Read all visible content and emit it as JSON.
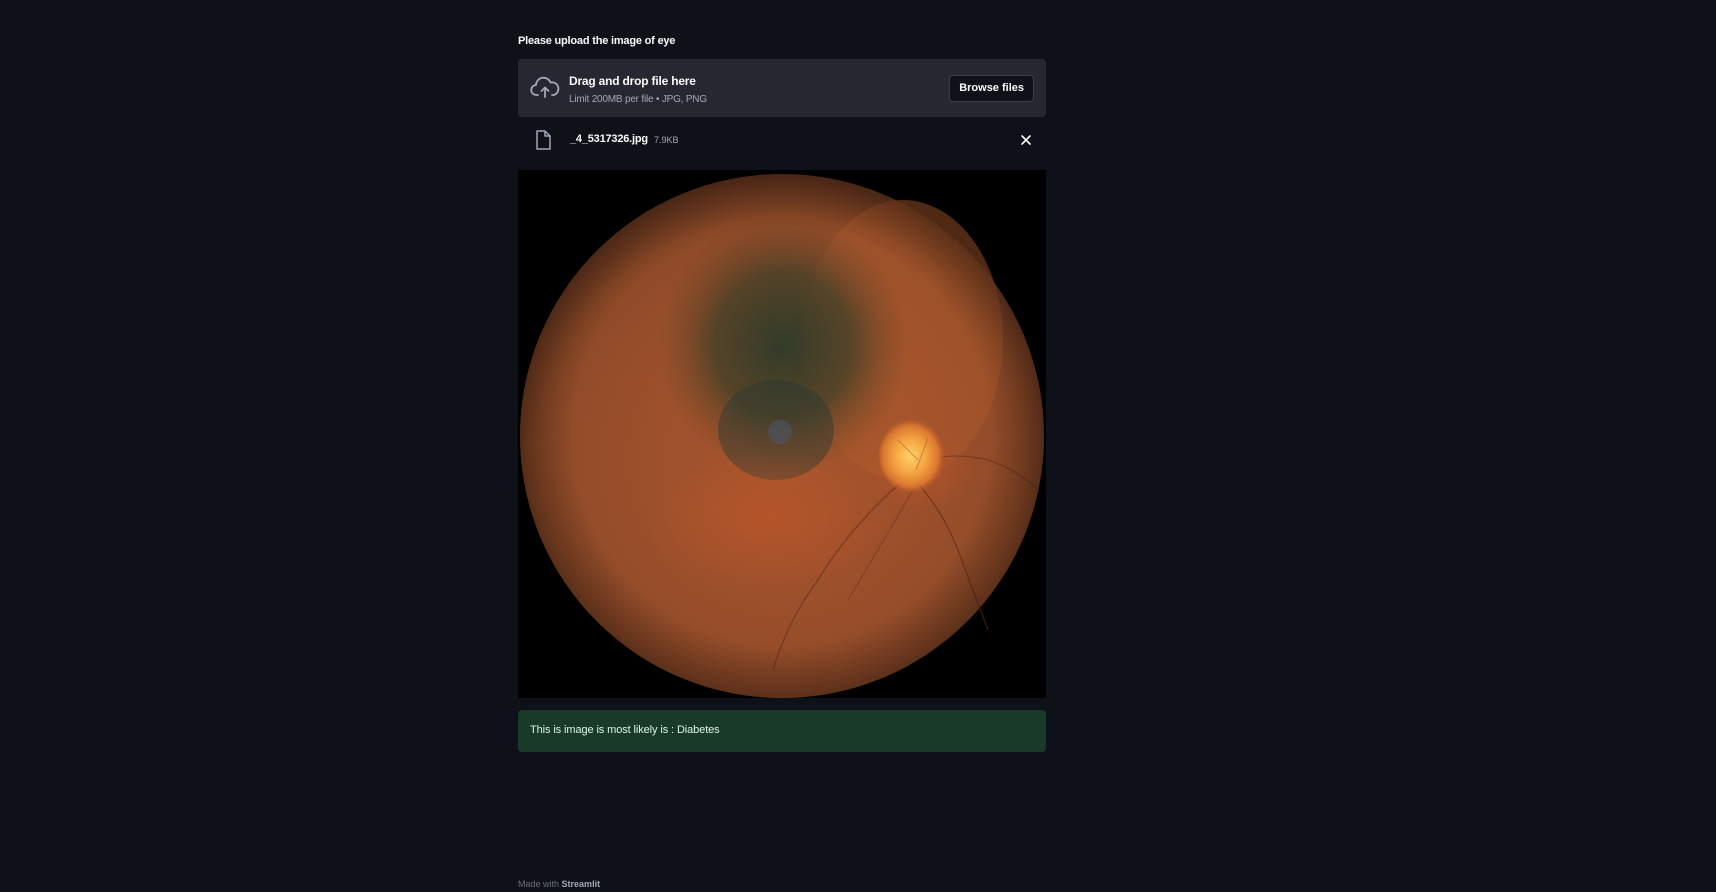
{
  "uploader": {
    "label": "Please upload the image of eye",
    "dropzone_title": "Drag and drop file here",
    "dropzone_subtitle": "Limit 200MB per file • JPG, PNG",
    "browse_label": "Browse files"
  },
  "uploaded_file": {
    "name": "_4_5317326.jpg",
    "size": "7.9KB"
  },
  "result": {
    "text": "This is image is most likely is : Diabetes"
  },
  "footer": {
    "prefix": "Made with",
    "brand": "Streamlit"
  },
  "icons": {
    "upload": "cloud-upload-icon",
    "file": "file-icon",
    "remove": "close-icon"
  },
  "colors": {
    "background": "#0e1117",
    "dropzone": "#262730",
    "success": "#1a3a29"
  }
}
